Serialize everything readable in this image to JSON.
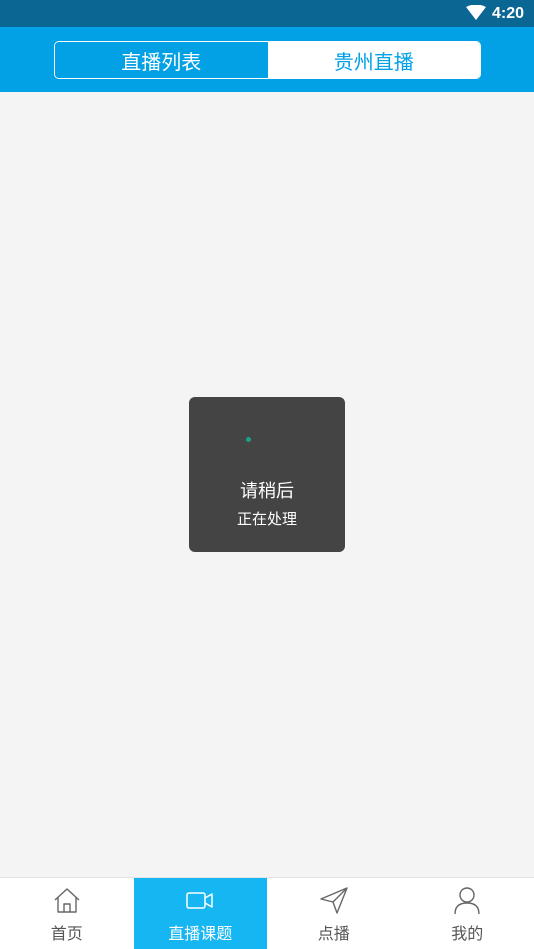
{
  "status_bar": {
    "time": "4:20",
    "icon": "wifi-icon"
  },
  "header": {
    "tabs": [
      {
        "label": "直播列表",
        "active": true
      },
      {
        "label": "贵州直播",
        "active": false
      }
    ],
    "accent_color": "#02a1e6"
  },
  "loading": {
    "title": "请稍后",
    "subtitle": "正在处理"
  },
  "tabbar": {
    "items": [
      {
        "label": "首页",
        "icon": "home-icon",
        "active": false
      },
      {
        "label": "直播课题",
        "icon": "video-camera-icon",
        "active": true
      },
      {
        "label": "点播",
        "icon": "paper-plane-icon",
        "active": false
      },
      {
        "label": "我的",
        "icon": "user-icon",
        "active": false
      }
    ],
    "active_color": "#15b6f2"
  }
}
